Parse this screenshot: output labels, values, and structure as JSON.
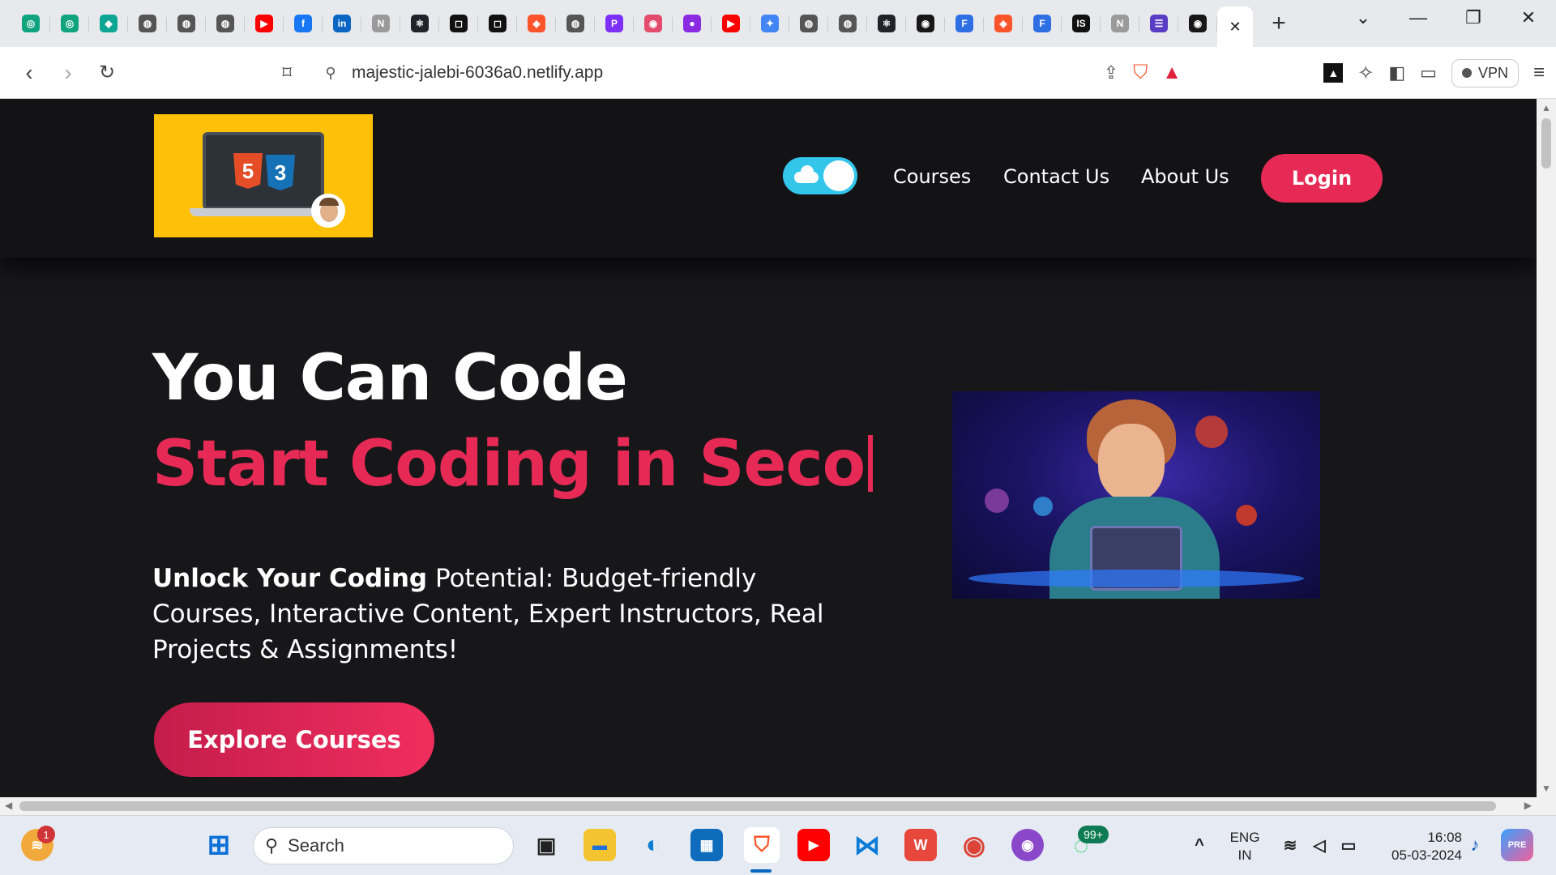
{
  "browser": {
    "tabs": [
      {
        "icon": "chatgpt-icon",
        "color": "#10a37f",
        "glyph": "◎"
      },
      {
        "icon": "chatgpt-icon",
        "color": "#10a37f",
        "glyph": "◎"
      },
      {
        "icon": "diamond-icon",
        "color": "#0fa593",
        "glyph": "◆"
      },
      {
        "icon": "globe-icon",
        "color": "#555555",
        "glyph": "◍"
      },
      {
        "icon": "globe-icon",
        "color": "#555555",
        "glyph": "◍"
      },
      {
        "icon": "globe-icon",
        "color": "#555555",
        "glyph": "◍"
      },
      {
        "icon": "youtube-icon",
        "color": "#ff0000",
        "glyph": "▶"
      },
      {
        "icon": "facebook-icon",
        "color": "#1877f2",
        "glyph": "f"
      },
      {
        "icon": "linkedin-icon",
        "color": "#0a66c2",
        "glyph": "in"
      },
      {
        "icon": "notion-icon",
        "color": "#9a9a9a",
        "glyph": "N"
      },
      {
        "icon": "react-icon",
        "color": "#20232a",
        "glyph": "⚛"
      },
      {
        "icon": "square-icon",
        "color": "#111111",
        "glyph": "◻"
      },
      {
        "icon": "square-icon",
        "color": "#111111",
        "glyph": "◻"
      },
      {
        "icon": "brave-icon",
        "color": "#fb542b",
        "glyph": "◈"
      },
      {
        "icon": "globe-icon",
        "color": "#555555",
        "glyph": "◍"
      },
      {
        "icon": "pink-p-icon",
        "color": "#7b2ff7",
        "glyph": "P"
      },
      {
        "icon": "strawberry-icon",
        "color": "#e34c6c",
        "glyph": "◉"
      },
      {
        "icon": "purple-circle-icon",
        "color": "#8a2be2",
        "glyph": "●"
      },
      {
        "icon": "youtube-icon",
        "color": "#ff0000",
        "glyph": "▶"
      },
      {
        "icon": "gemini-icon",
        "color": "#4285f4",
        "glyph": "✦"
      },
      {
        "icon": "globe-icon",
        "color": "#555555",
        "glyph": "◍"
      },
      {
        "icon": "globe-icon",
        "color": "#555555",
        "glyph": "◍"
      },
      {
        "icon": "react-icon",
        "color": "#20232a",
        "glyph": "⚛"
      },
      {
        "icon": "github-icon",
        "color": "#181717",
        "glyph": "◉"
      },
      {
        "icon": "form-icon",
        "color": "#2f6fe4",
        "glyph": "F"
      },
      {
        "icon": "brave-icon",
        "color": "#fb542b",
        "glyph": "◈"
      },
      {
        "icon": "form-icon",
        "color": "#2f6fe4",
        "glyph": "F"
      },
      {
        "icon": "is-icon",
        "color": "#111111",
        "glyph": "IS"
      },
      {
        "icon": "notion-icon",
        "color": "#9a9a9a",
        "glyph": "N"
      },
      {
        "icon": "list-icon",
        "color": "#5b3cc4",
        "glyph": "☰"
      },
      {
        "icon": "github-icon",
        "color": "#181717",
        "glyph": "◉"
      }
    ],
    "active_tab_close": "✕",
    "new_tab": "+",
    "url": "majestic-jalebi-6036a0.netlify.app",
    "vpn_label": "VPN"
  },
  "site": {
    "nav": {
      "courses": "Courses",
      "contact": "Contact Us",
      "about": "About Us",
      "login": "Login"
    },
    "hero": {
      "title": "You Can Code",
      "subtitle": "Start Coding in Seco",
      "desc_bold": "Unlock Your Coding",
      "desc_rest": " Potential: Budget-friendly Courses, Interactive Content, Expert Instructors, Real Projects & Assignments!",
      "cta": "Explore Courses"
    },
    "logo_badges": {
      "html": "5",
      "css": "3"
    }
  },
  "taskbar": {
    "notification_count": "1",
    "search_placeholder": "Search",
    "whatsapp_badge": "99+",
    "lang_top": "ENG",
    "lang_bottom": "IN",
    "time": "16:08",
    "date": "05-03-2024"
  }
}
